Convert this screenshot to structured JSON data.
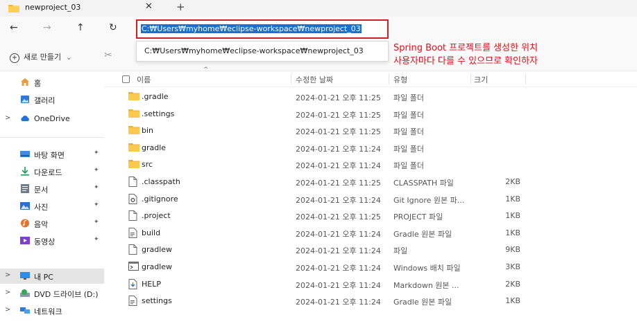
{
  "tab": {
    "title": "newproject_03",
    "close": "✕",
    "new_tab": "+"
  },
  "nav": {
    "back": "←",
    "forward": "→",
    "up": "↑",
    "refresh": "↻"
  },
  "address": {
    "value": "C:₩Users₩myhome₩eclipse-workspace₩newproject_03"
  },
  "suggestion": {
    "text": "C:₩Users₩myhome₩eclipse-workspace₩newproject_03"
  },
  "command": {
    "new_label": "새로 만들기",
    "new_icon": "+",
    "chevron": "⌄",
    "cut_icon": "✂"
  },
  "annotation": {
    "line1": "Spring Boot 프로젝트를 생성한 위치",
    "line2": "사용자마다 다를 수 있으므로 확인하자",
    "color": "#e0121b"
  },
  "sidebar": {
    "items": [
      {
        "label": "홈",
        "icon": "home-icon",
        "chev": ""
      },
      {
        "label": "갤러리",
        "icon": "gallery-icon",
        "chev": ""
      },
      {
        "label": "OneDrive",
        "icon": "cloud-icon",
        "chev": ">"
      },
      {
        "label": "바탕 화면",
        "icon": "desktop-icon",
        "chev": "",
        "pin": "✦"
      },
      {
        "label": "다운로드",
        "icon": "download-icon",
        "chev": "",
        "pin": "✦"
      },
      {
        "label": "문서",
        "icon": "document-icon",
        "chev": "",
        "pin": "✦"
      },
      {
        "label": "사진",
        "icon": "pictures-icon",
        "chev": "",
        "pin": "✦"
      },
      {
        "label": "음악",
        "icon": "music-icon",
        "chev": "",
        "pin": "✦"
      },
      {
        "label": "동영상",
        "icon": "video-icon",
        "chev": "",
        "pin": "✦"
      },
      {
        "label": "내 PC",
        "icon": "pc-icon",
        "chev": ">"
      },
      {
        "label": "DVD 드라이브 (D:)",
        "icon": "dvd-icon",
        "chev": ">"
      },
      {
        "label": "네트워크",
        "icon": "network-icon",
        "chev": ">"
      }
    ]
  },
  "columns": {
    "name": "이름",
    "date": "수정한 날짜",
    "type": "유형",
    "size": "크기",
    "sort": "^"
  },
  "files": [
    {
      "name": ".gradle",
      "date": "2024-01-21 오후 11:25",
      "type": "파일 폴더",
      "size": "",
      "kind": "folder"
    },
    {
      "name": ".settings",
      "date": "2024-01-21 오후 11:25",
      "type": "파일 폴더",
      "size": "",
      "kind": "folder"
    },
    {
      "name": "bin",
      "date": "2024-01-21 오후 11:25",
      "type": "파일 폴더",
      "size": "",
      "kind": "folder"
    },
    {
      "name": "gradle",
      "date": "2024-01-21 오후 11:24",
      "type": "파일 폴더",
      "size": "",
      "kind": "folder"
    },
    {
      "name": "src",
      "date": "2024-01-21 오후 11:24",
      "type": "파일 폴더",
      "size": "",
      "kind": "folder"
    },
    {
      "name": ".classpath",
      "date": "2024-01-21 오후 11:25",
      "type": "CLASSPATH 파일",
      "size": "2KB",
      "kind": "file"
    },
    {
      "name": ".gitignore",
      "date": "2024-01-21 오후 11:24",
      "type": "Git Ignore 원본 파...",
      "size": "1KB",
      "kind": "gear"
    },
    {
      "name": ".project",
      "date": "2024-01-21 오후 11:25",
      "type": "PROJECT 파일",
      "size": "1KB",
      "kind": "file"
    },
    {
      "name": "build",
      "date": "2024-01-21 오후 11:24",
      "type": "Gradle 원본 파일",
      "size": "1KB",
      "kind": "text"
    },
    {
      "name": "gradlew",
      "date": "2024-01-21 오후 11:24",
      "type": "파일",
      "size": "9KB",
      "kind": "file"
    },
    {
      "name": "gradlew",
      "date": "2024-01-21 오후 11:24",
      "type": "Windows 배치 파일",
      "size": "3KB",
      "kind": "batch"
    },
    {
      "name": "HELP",
      "date": "2024-01-21 오후 11:24",
      "type": "Markdown 원본 ...",
      "size": "2KB",
      "kind": "markdown"
    },
    {
      "name": "settings",
      "date": "2024-01-21 오후 11:24",
      "type": "Gradle 원본 파일",
      "size": "1KB",
      "kind": "text"
    }
  ]
}
